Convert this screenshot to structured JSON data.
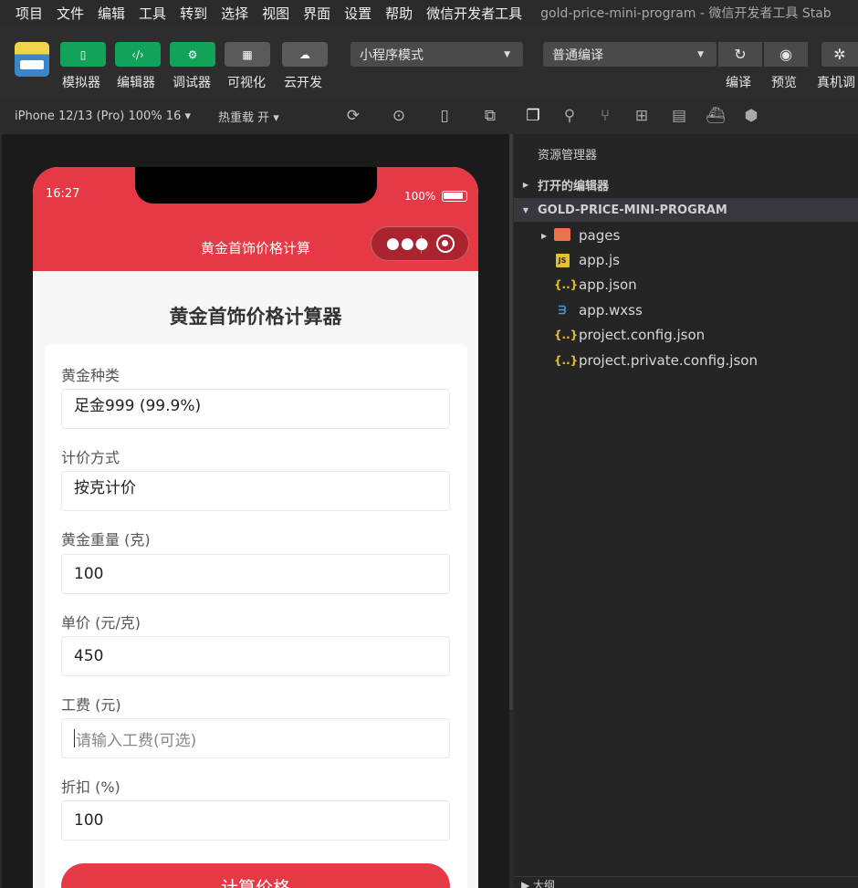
{
  "menu": [
    "项目",
    "文件",
    "编辑",
    "工具",
    "转到",
    "选择",
    "视图",
    "界面",
    "设置",
    "帮助",
    "微信开发者工具"
  ],
  "window_title": "gold-price-mini-program - 微信开发者工具 Stab",
  "toolbar": {
    "simulator": "模拟器",
    "editor": "编辑器",
    "debugger": "调试器",
    "visual": "可视化",
    "cloud": "云开发",
    "mode_select": "小程序模式",
    "compile_select": "普通编译",
    "compile": "编译",
    "preview": "预览",
    "real_debug": "真机调"
  },
  "simbar": {
    "device": "iPhone 12/13 (Pro) 100% 16 ▾",
    "hot_reload": "热重载 开 ▾"
  },
  "phone": {
    "time": "16:27",
    "battery": "100%",
    "nav_title": "黄金首饰价格计算",
    "page_title": "黄金首饰价格计算器",
    "fields": {
      "gold_type_label": "黄金种类",
      "gold_type_value": "足金999 (99.9%)",
      "pricing_label": "计价方式",
      "pricing_value": "按克计价",
      "weight_label": "黄金重量 (克)",
      "weight_value": "100",
      "unit_price_label": "单价 (元/克)",
      "unit_price_value": "450",
      "labor_label": "工费 (元)",
      "labor_placeholder": "请输入工费(可选)",
      "discount_label": "折扣 (%)",
      "discount_value": "100"
    },
    "calc_button": "计算价格"
  },
  "explorer": {
    "title": "资源管理器",
    "open_editors": "打开的编辑器",
    "project": "GOLD-PRICE-MINI-PROGRAM",
    "files": [
      {
        "name": "pages",
        "type": "folder"
      },
      {
        "name": "app.js",
        "type": "js"
      },
      {
        "name": "app.json",
        "type": "json"
      },
      {
        "name": "app.wxss",
        "type": "css"
      },
      {
        "name": "project.config.json",
        "type": "json"
      },
      {
        "name": "project.private.config.json",
        "type": "json"
      }
    ],
    "outline": "大纲"
  },
  "colors": {
    "accent": "#e63946",
    "green_button": "#12a25a"
  }
}
